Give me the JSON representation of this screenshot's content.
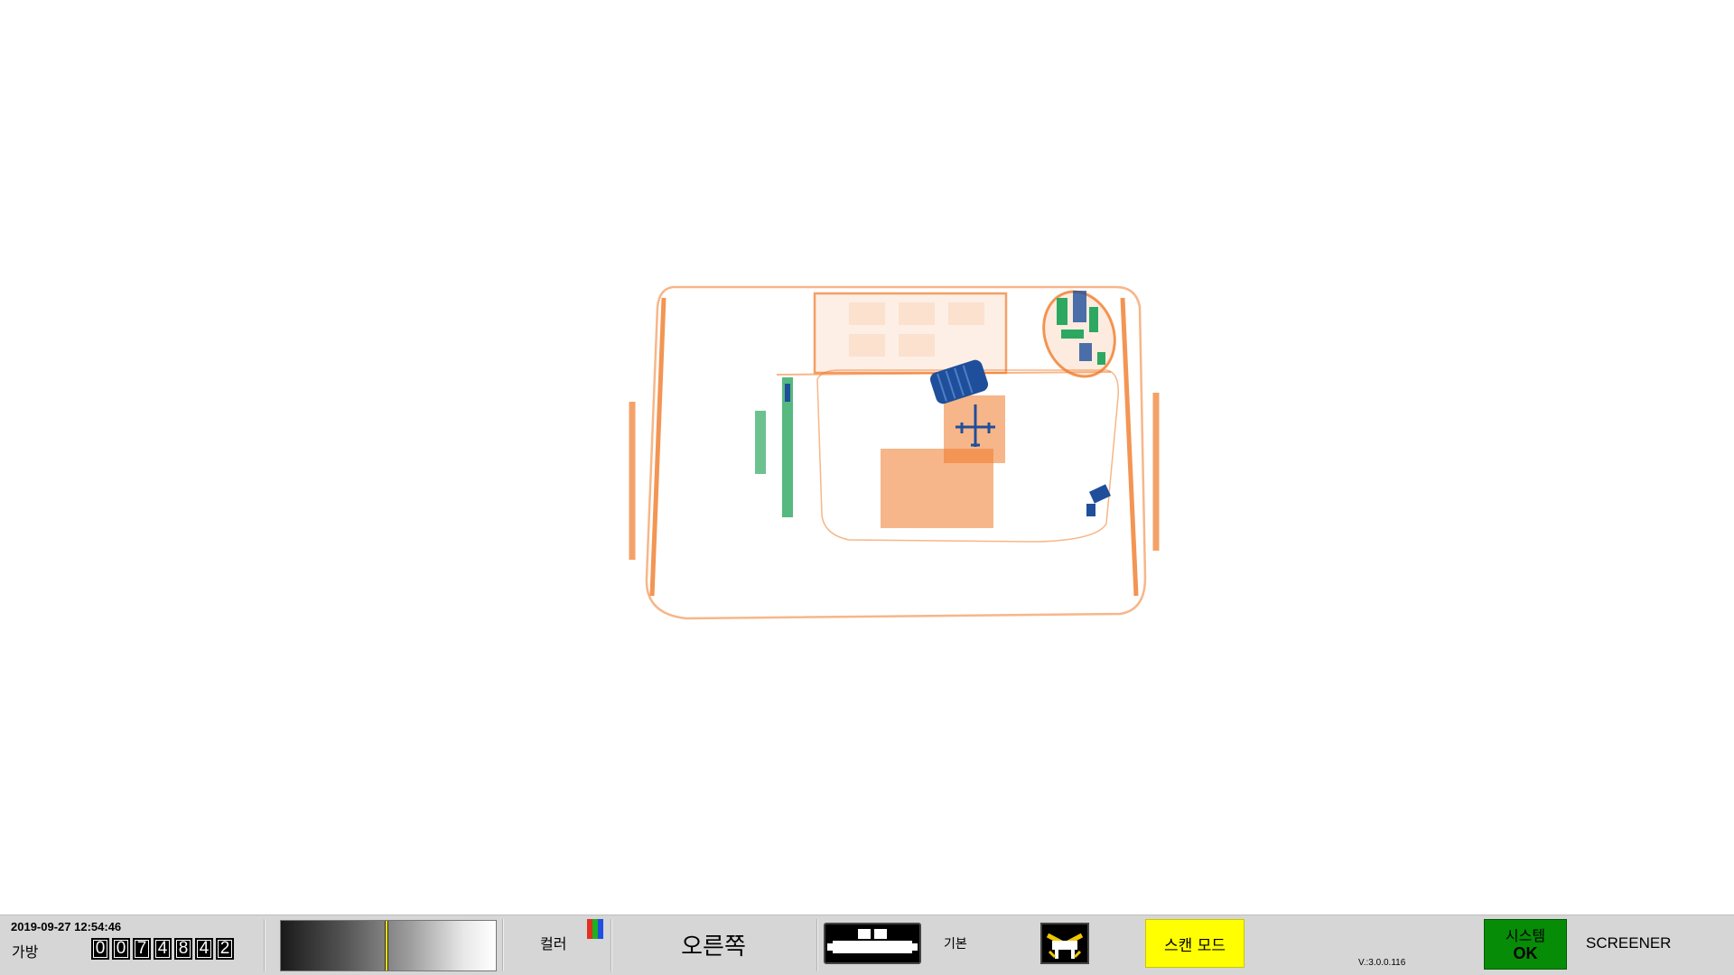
{
  "status_bar": {
    "datetime": "2019-09-27 12:54:46",
    "bag_label": "가방",
    "bag_count_digits": [
      "0",
      "0",
      "7",
      "4",
      "8",
      "4",
      "2"
    ],
    "color_label": "컬러",
    "color_bar_colors": [
      "#e03020",
      "#20b020",
      "#2050e0"
    ],
    "direction": "오른쪽",
    "basic_label": "기본",
    "scan_mode_label": "스캔 모드",
    "version": "V.:3.0.0.116",
    "system_label": "시스템",
    "system_value": "OK",
    "operator": "SCREENER",
    "gradient_level_percent": 49
  },
  "colors": {
    "organic": "#f07a28",
    "inorganic": "#2ca860",
    "metal": "#1f4f9a",
    "status_ok": "#078c07",
    "scan_mode_bg": "#ffff00",
    "marker": "#f0e000"
  },
  "xray_image": {
    "icon": "xray-baggage-scan",
    "palette": [
      "organic",
      "inorganic",
      "metal"
    ]
  }
}
